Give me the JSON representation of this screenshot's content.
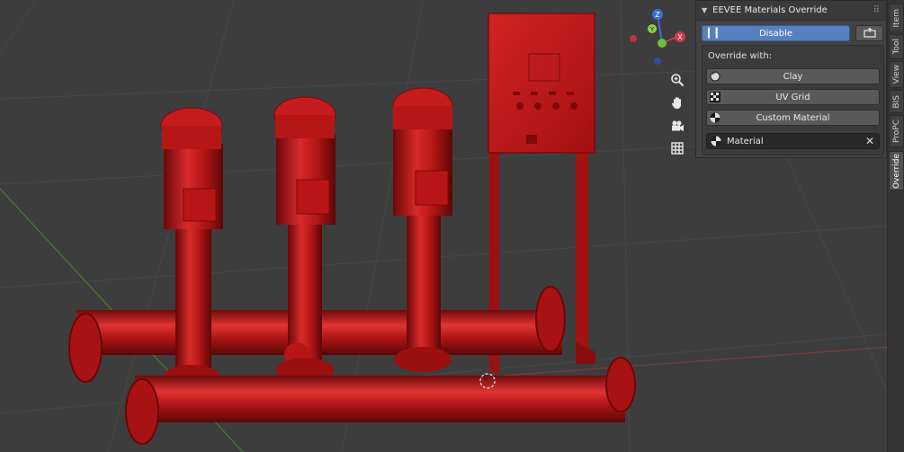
{
  "panel": {
    "title": "EEVEE Materials Override",
    "disable_label": "Disable",
    "override_label": "Override with:",
    "clay_label": "Clay",
    "uvgrid_label": "UV Grid",
    "custom_label": "Custom Material",
    "material_value": "Material"
  },
  "gizmo": {
    "z": "Z",
    "y": "Y",
    "x": "X"
  },
  "tabs": [
    "Item",
    "Tool",
    "View",
    "BIS",
    "ProPC",
    "Override"
  ],
  "colors": {
    "viewport_bg": "#3d3d3d",
    "accent": "#5680c2",
    "model_red": "#c01818",
    "x_axis": "#d03a4a",
    "y_axis": "#6ec03a",
    "z_axis": "#3a6ed0"
  },
  "icons": [
    "zoom-icon",
    "hand-pan-icon",
    "camera-icon",
    "grid-icon",
    "move-icon",
    "clay-sphere-icon",
    "checker-icon",
    "material-sphere-icon",
    "close-icon"
  ]
}
